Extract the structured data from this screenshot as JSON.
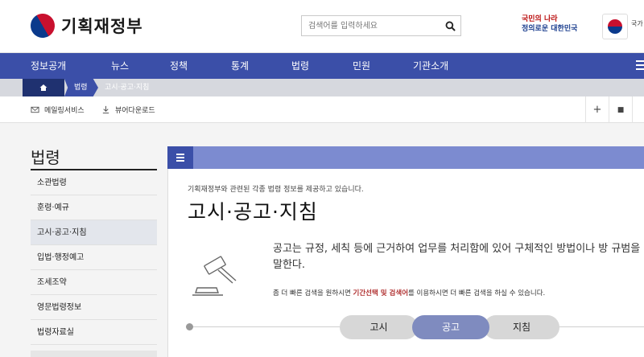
{
  "header": {
    "logo_text": "기획재정부",
    "search_placeholder": "검색어를 입력하세요",
    "slogan_line1": "국민의 나라",
    "slogan_line2": "정의로운 대한민국",
    "cut_text": "국가"
  },
  "nav": {
    "items": [
      "정보공개",
      "뉴스",
      "정책",
      "통계",
      "법령",
      "민원",
      "기관소개"
    ]
  },
  "breadcrumb": {
    "level1": "법령",
    "current": "고시·공고·지침"
  },
  "toolbar": {
    "mailing": "메일링서비스",
    "viewer": "뷰어다운로드",
    "plus": "+",
    "square": "■"
  },
  "sidebar": {
    "title": "법령",
    "items": [
      "소관법령",
      "훈령·예규",
      "고시·공고·지침",
      "입법·행정예고",
      "조세조약",
      "영문법령정보",
      "법령자료실"
    ],
    "active_index": 2
  },
  "content": {
    "intro": "기획재정부와 관련된 각종 법령 정보를 제공하고 있습니다.",
    "title": "고시·공고·지침",
    "desc": "공고는 규정, 세칙 등에 근거하여 업무를 처리함에 있어 구체적인 방법이나 방 규범을 말한다.",
    "note_pre": "좀 더 빠른 검색을 원하시면 ",
    "note_highlight": "기간선택 및 검색어",
    "note_post": "를 이용하시면 더 빠른 검색을 하실 수 있습니다.",
    "tabs": [
      "고시",
      "공고",
      "지침"
    ],
    "active_tab": 1
  },
  "colors": {
    "nav_bg": "#3b4fa8",
    "bc_dark": "#1f3170",
    "accent_tab": "#7f8bbf",
    "highlight": "#b03030"
  }
}
